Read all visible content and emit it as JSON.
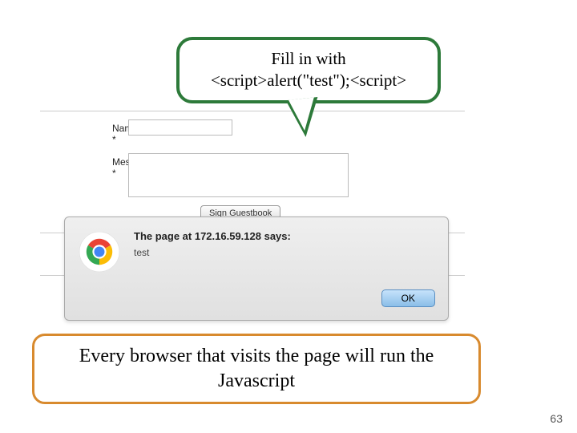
{
  "callout_top": {
    "line1": "Fill in with",
    "line2": "<script>alert(\"test\");<script>"
  },
  "form": {
    "name_label": "Name *",
    "message_label": "Message *",
    "name_value": "",
    "message_value": "",
    "submit_label": "Sign Guestbook",
    "cut_na": "Na",
    "cut_me": "Me"
  },
  "dialog": {
    "title": "The page at 172.16.59.128 says:",
    "message": "test",
    "ok_label": "OK",
    "icon": "chrome-icon"
  },
  "callout_bottom": "Every browser that visits the page will run the Javascript",
  "page_number": "63"
}
